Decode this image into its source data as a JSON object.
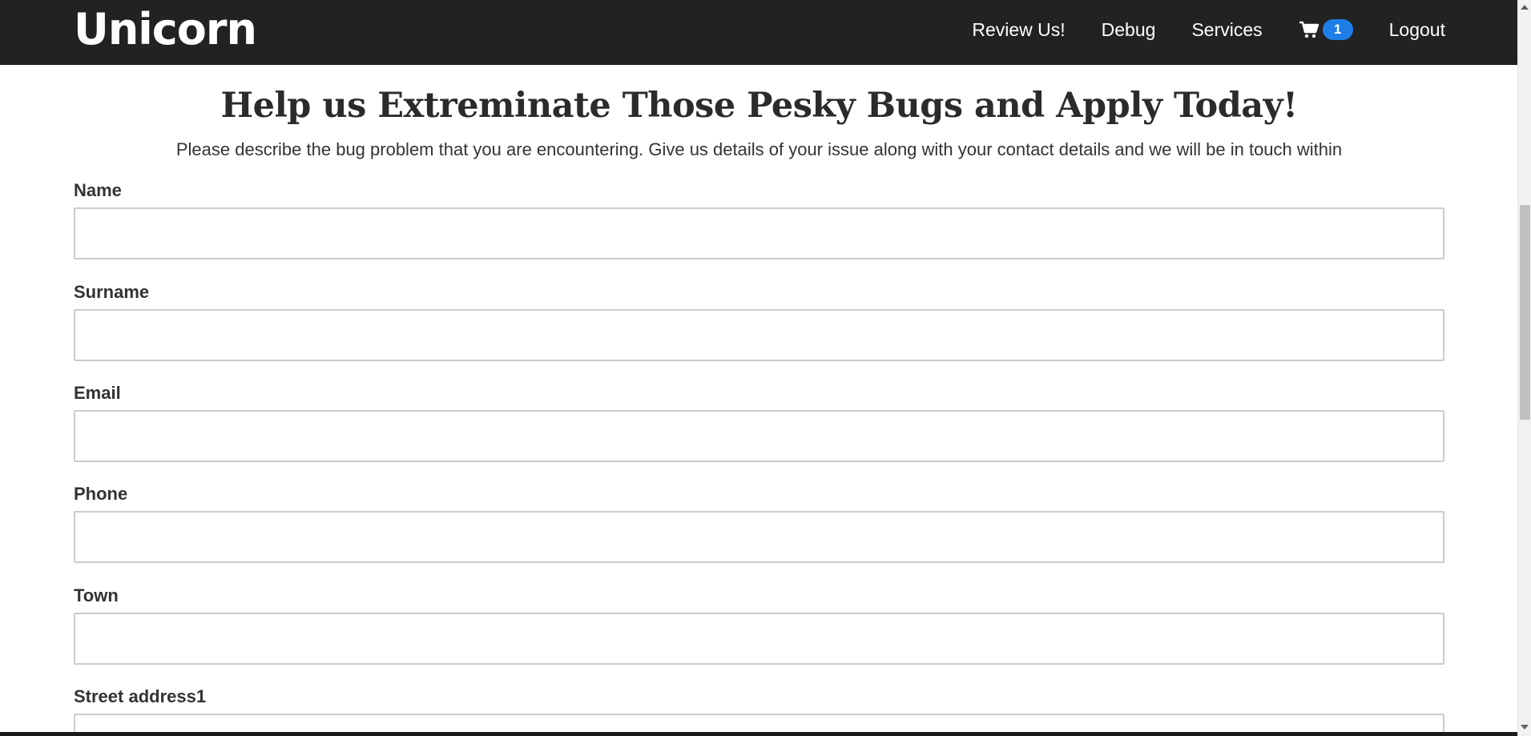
{
  "navbar": {
    "brand": "Unicorn",
    "links": {
      "review": "Review Us!",
      "debug": "Debug",
      "services": "Services",
      "logout": "Logout"
    },
    "cart_count": "1",
    "cart_icon": "cart-icon",
    "badge_color": "#1e7ee8",
    "background": "#222222"
  },
  "main": {
    "title": "Help us Extreminate Those Pesky Bugs and Apply Today!",
    "intro": "Please describe the bug problem that you are encountering. Give us details of your issue along with your contact details and we will be in touch within"
  },
  "form": {
    "fields": [
      {
        "label": "Name",
        "value": "",
        "placeholder": ""
      },
      {
        "label": "Surname",
        "value": "",
        "placeholder": ""
      },
      {
        "label": "Email",
        "value": "",
        "placeholder": ""
      },
      {
        "label": "Phone",
        "value": "",
        "placeholder": ""
      },
      {
        "label": "Town",
        "value": "",
        "placeholder": ""
      },
      {
        "label": "Street address1",
        "value": "",
        "placeholder": ""
      }
    ]
  }
}
